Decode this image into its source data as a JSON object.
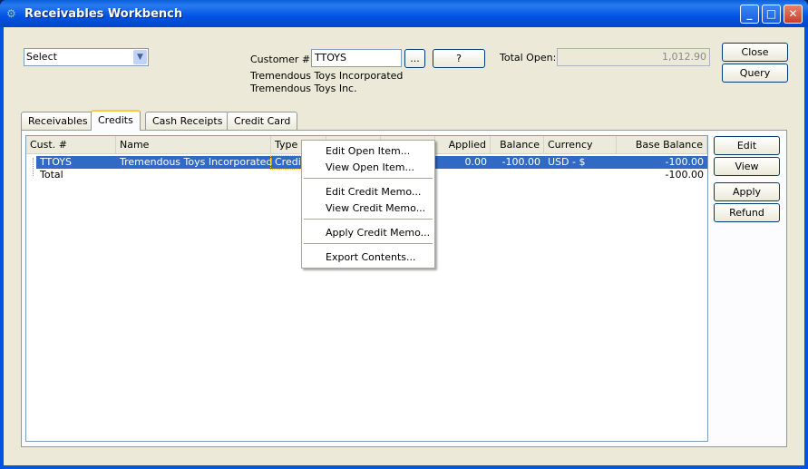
{
  "window": {
    "title": "Receivables Workbench",
    "min": "_",
    "max": "□",
    "close": "✕"
  },
  "filter": {
    "selected": "Select"
  },
  "customer": {
    "label": "Customer #:",
    "value": "TTOYS",
    "lookup": "...",
    "help": "?",
    "name1": "Tremendous Toys Incorporated",
    "name2": "Tremendous Toys Inc."
  },
  "total_open": {
    "label": "Total Open:",
    "value": "1,012.90"
  },
  "buttons": {
    "close": "Close",
    "query": "Query",
    "edit": "Edit",
    "view": "View",
    "apply": "Apply",
    "refund": "Refund"
  },
  "tabs": [
    "Receivables",
    "Credits",
    "Cash Receipts",
    "Credit Card"
  ],
  "columns": [
    "Cust. #",
    "Name",
    "Type",
    "",
    "",
    "Applied",
    "Balance",
    "Currency",
    "Base Balance"
  ],
  "rows": [
    {
      "cust": "TTOYS",
      "name": "Tremendous Toys Incorporated",
      "type": "Credit",
      "applied": "0.00",
      "balance": "-100.00",
      "currency": "USD - $",
      "base_balance": "-100.00"
    },
    {
      "cust": "Total",
      "base_balance": "-100.00"
    }
  ],
  "context_menu": [
    "Edit Open Item...",
    "View Open Item...",
    "Edit Credit Memo...",
    "View Credit Memo...",
    "Apply Credit Memo...",
    "Export Contents..."
  ]
}
